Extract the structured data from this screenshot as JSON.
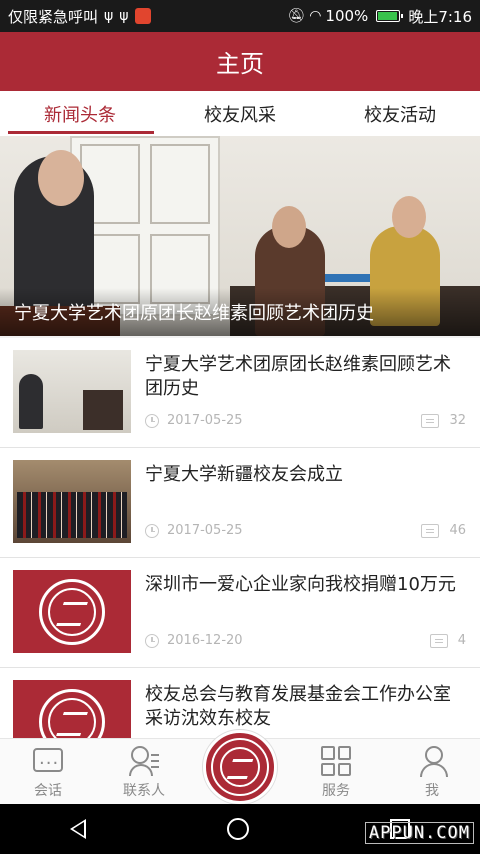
{
  "status_bar": {
    "left_text": "仅限紧急呼叫",
    "battery": "100%",
    "time": "晚上7:16",
    "icons": [
      "usb-icon",
      "usb-icon",
      "weibo-icon",
      "mute-icon",
      "wifi-icon",
      "battery-icon"
    ]
  },
  "header": {
    "title": "主页"
  },
  "tabs": [
    {
      "label": "新闻头条",
      "active": true
    },
    {
      "label": "校友风采",
      "active": false
    },
    {
      "label": "校友活动",
      "active": false
    }
  ],
  "hero": {
    "caption": "宁夏大学艺术团原团长赵维素回顾艺术团历史"
  },
  "news": [
    {
      "title": "宁夏大学艺术团原团长赵维素回顾艺术团历史",
      "date": "2017-05-25",
      "comments": "32",
      "thumb": "photo1"
    },
    {
      "title": "宁夏大学新疆校友会成立",
      "date": "2017-05-25",
      "comments": "46",
      "thumb": "photo2"
    },
    {
      "title": "深圳市一爱心企业家向我校捐赠10万元",
      "date": "2016-12-20",
      "comments": "4",
      "thumb": "logo"
    },
    {
      "title": "校友总会与教育发展基金会工作办公室采访沈效东校友",
      "date": "",
      "comments": "",
      "thumb": "logo"
    }
  ],
  "bottom_nav": [
    {
      "label": "会话",
      "icon": "chat-icon"
    },
    {
      "label": "联系人",
      "icon": "contacts-icon"
    },
    {
      "label": "",
      "icon": "university-logo"
    },
    {
      "label": "服务",
      "icon": "service-icon"
    },
    {
      "label": "我",
      "icon": "profile-icon"
    }
  ],
  "watermark": "APPUN.COM",
  "colors": {
    "brand": "#ab2a36"
  }
}
